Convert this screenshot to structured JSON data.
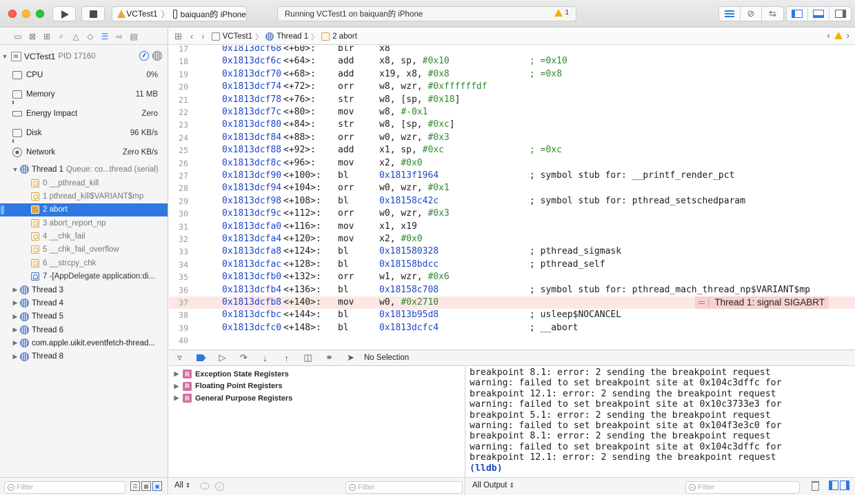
{
  "toolbar": {
    "scheme_app": "VCTest1",
    "scheme_device": "baiquan的 iPhone",
    "status_text": "Running VCTest1 on baiquan的 iPhone",
    "warning_count": "1",
    "editor_icons": [
      "standard-editor-icon",
      "assistant-editor-icon",
      "version-editor-icon"
    ],
    "view_icons": [
      "navigator-toggle-icon",
      "debug-area-toggle-icon",
      "utilities-toggle-icon"
    ]
  },
  "navigator": {
    "tab_icons": [
      "folder-icon",
      "source-control-icon",
      "hierarchy-icon",
      "find-icon",
      "issue-icon",
      "test-icon",
      "debug-icon",
      "breakpoint-icon",
      "report-icon"
    ],
    "process": {
      "name": "VCTest1",
      "pid": "PID 17160"
    },
    "gauges": [
      {
        "label": "CPU",
        "value": "0%"
      },
      {
        "label": "Memory",
        "value": "11 MB"
      },
      {
        "label": "Energy Impact",
        "value": "Zero"
      },
      {
        "label": "Disk",
        "value": "96 KB/s"
      },
      {
        "label": "Network",
        "value": "Zero KB/s"
      }
    ],
    "thread1": {
      "name": "Thread 1",
      "queue": "Queue: co...thread (serial)"
    },
    "frames": [
      {
        "label": "0 __pthread_kill",
        "kind": "system"
      },
      {
        "label": "1 pthread_kill$VARIANT$mp",
        "kind": "system"
      },
      {
        "label": "2 abort",
        "kind": "system",
        "selected": true
      },
      {
        "label": "3 abort_report_np",
        "kind": "system"
      },
      {
        "label": "4 __chk_fail",
        "kind": "system"
      },
      {
        "label": "5 __chk_fail_overflow",
        "kind": "system"
      },
      {
        "label": "6 __strcpy_chk",
        "kind": "system"
      },
      {
        "label": "7 -[AppDelegate application:di...",
        "kind": "user"
      }
    ],
    "other_threads": [
      "Thread 3",
      "Thread 4",
      "Thread 5",
      "Thread 6",
      "com.apple.uikit.eventfetch-thread...",
      "Thread 8"
    ],
    "filter_placeholder": "Filter"
  },
  "jumpbar": {
    "items": [
      "VCTest1",
      "Thread 1",
      "2 abort"
    ]
  },
  "code_lines": [
    {
      "ln": "17",
      "addr": "0x1813dcf68",
      "off": "<+60>:",
      "mn": "blr",
      "ops": [
        [
          "x8",
          ""
        ]
      ],
      "cmt": "",
      "cmt_green": false
    },
    {
      "ln": "18",
      "addr": "0x1813dcf6c",
      "off": "<+64>:",
      "mn": "add",
      "ops": [
        [
          "x8, sp, ",
          ""
        ],
        [
          "#0x10",
          "num"
        ]
      ],
      "cmt": "; =0x10",
      "cmt_green": true
    },
    {
      "ln": "19",
      "addr": "0x1813dcf70",
      "off": "<+68>:",
      "mn": "add",
      "ops": [
        [
          "x19, x8, ",
          ""
        ],
        [
          "#0x8",
          "num"
        ]
      ],
      "cmt": "; =0x8",
      "cmt_green": true
    },
    {
      "ln": "20",
      "addr": "0x1813dcf74",
      "off": "<+72>:",
      "mn": "orr",
      "ops": [
        [
          "w8, wzr, ",
          ""
        ],
        [
          "#0xffffffdf",
          "num"
        ]
      ],
      "cmt": "",
      "cmt_green": false
    },
    {
      "ln": "21",
      "addr": "0x1813dcf78",
      "off": "<+76>:",
      "mn": "str",
      "ops": [
        [
          "w8, [sp, ",
          ""
        ],
        [
          "#0x18",
          "num"
        ],
        [
          "]",
          ""
        ]
      ],
      "cmt": "",
      "cmt_green": false
    },
    {
      "ln": "22",
      "addr": "0x1813dcf7c",
      "off": "<+80>:",
      "mn": "mov",
      "ops": [
        [
          "w8, ",
          ""
        ],
        [
          "#-0x1",
          "num"
        ]
      ],
      "cmt": "",
      "cmt_green": false
    },
    {
      "ln": "23",
      "addr": "0x1813dcf80",
      "off": "<+84>:",
      "mn": "str",
      "ops": [
        [
          "w8, [sp, ",
          ""
        ],
        [
          "#0xc",
          "num"
        ],
        [
          "]",
          ""
        ]
      ],
      "cmt": "",
      "cmt_green": false
    },
    {
      "ln": "24",
      "addr": "0x1813dcf84",
      "off": "<+88>:",
      "mn": "orr",
      "ops": [
        [
          "w0, wzr, ",
          ""
        ],
        [
          "#0x3",
          "num"
        ]
      ],
      "cmt": "",
      "cmt_green": false
    },
    {
      "ln": "25",
      "addr": "0x1813dcf88",
      "off": "<+92>:",
      "mn": "add",
      "ops": [
        [
          "x1, sp, ",
          ""
        ],
        [
          "#0xc",
          "num"
        ]
      ],
      "cmt": "; =0xc",
      "cmt_green": true
    },
    {
      "ln": "26",
      "addr": "0x1813dcf8c",
      "off": "<+96>:",
      "mn": "mov",
      "ops": [
        [
          "x2, ",
          ""
        ],
        [
          "#0x0",
          "num"
        ]
      ],
      "cmt": "",
      "cmt_green": false
    },
    {
      "ln": "27",
      "addr": "0x1813dcf90",
      "off": "<+100>:",
      "mn": "bl",
      "ops": [
        [
          "0x1813f1964",
          "addr2"
        ]
      ],
      "cmt": "; symbol stub for: __printf_render_pct",
      "cmt_green": false
    },
    {
      "ln": "28",
      "addr": "0x1813dcf94",
      "off": "<+104>:",
      "mn": "orr",
      "ops": [
        [
          "w0, wzr, ",
          ""
        ],
        [
          "#0x1",
          "num"
        ]
      ],
      "cmt": "",
      "cmt_green": false
    },
    {
      "ln": "29",
      "addr": "0x1813dcf98",
      "off": "<+108>:",
      "mn": "bl",
      "ops": [
        [
          "0x18158c42c",
          "addr2"
        ]
      ],
      "cmt": "; symbol stub for: pthread_setschedparam",
      "cmt_green": false
    },
    {
      "ln": "30",
      "addr": "0x1813dcf9c",
      "off": "<+112>:",
      "mn": "orr",
      "ops": [
        [
          "w0, wzr, ",
          ""
        ],
        [
          "#0x3",
          "num"
        ]
      ],
      "cmt": "",
      "cmt_green": false
    },
    {
      "ln": "31",
      "addr": "0x1813dcfa0",
      "off": "<+116>:",
      "mn": "mov",
      "ops": [
        [
          "x1, x19",
          ""
        ]
      ],
      "cmt": "",
      "cmt_green": false
    },
    {
      "ln": "32",
      "addr": "0x1813dcfa4",
      "off": "<+120>:",
      "mn": "mov",
      "ops": [
        [
          "x2, ",
          ""
        ],
        [
          "#0x0",
          "num"
        ]
      ],
      "cmt": "",
      "cmt_green": false
    },
    {
      "ln": "33",
      "addr": "0x1813dcfa8",
      "off": "<+124>:",
      "mn": "bl",
      "ops": [
        [
          "0x181580328",
          "addr2"
        ]
      ],
      "cmt": "; pthread_sigmask",
      "cmt_green": false
    },
    {
      "ln": "34",
      "addr": "0x1813dcfac",
      "off": "<+128>:",
      "mn": "bl",
      "ops": [
        [
          "0x18158bdcc",
          "addr2"
        ]
      ],
      "cmt": "; pthread_self",
      "cmt_green": false
    },
    {
      "ln": "35",
      "addr": "0x1813dcfb0",
      "off": "<+132>:",
      "mn": "orr",
      "ops": [
        [
          "w1, wzr, ",
          ""
        ],
        [
          "#0x6",
          "num"
        ]
      ],
      "cmt": "",
      "cmt_green": false
    },
    {
      "ln": "36",
      "addr": "0x1813dcfb4",
      "off": "<+136>:",
      "mn": "bl",
      "ops": [
        [
          "0x18158c708",
          "addr2"
        ]
      ],
      "cmt": "; symbol stub for: pthread_mach_thread_np$VARIANT$mp",
      "cmt_green": false
    },
    {
      "ln": "37",
      "addr": "0x1813dcfb8",
      "off": "<+140>:",
      "mn": "mov",
      "ops": [
        [
          "w0, ",
          ""
        ],
        [
          "#0x2710",
          "num"
        ]
      ],
      "cmt": "",
      "cmt_green": false,
      "crash": "Thread 1: signal SIGABRT"
    },
    {
      "ln": "38",
      "addr": "0x1813dcfbc",
      "off": "<+144>:",
      "mn": "bl",
      "ops": [
        [
          "0x1813b95d8",
          "addr2"
        ]
      ],
      "cmt": "; usleep$NOCANCEL",
      "cmt_green": false
    },
    {
      "ln": "39",
      "addr": "0x1813dcfc0",
      "off": "<+148>:",
      "mn": "bl",
      "ops": [
        [
          "0x1813dcfc4",
          "addr2"
        ]
      ],
      "cmt": "; __abort",
      "cmt_green": false
    },
    {
      "ln": "40",
      "addr": "",
      "off": "",
      "mn": "",
      "ops": [],
      "cmt": "",
      "cmt_green": false
    }
  ],
  "debugbar": {
    "selection": "No Selection"
  },
  "variables": {
    "groups": [
      "Exception State Registers",
      "Floating Point Registers",
      "General Purpose Registers"
    ],
    "scope": "All",
    "filter_placeholder": "Filter"
  },
  "console": {
    "lines": [
      "breakpoint 8.1: error: 2 sending the breakpoint request",
      "warning: failed to set breakpoint site at 0x104c3dffc for",
      "breakpoint 12.1: error: 2 sending the breakpoint request",
      "warning: failed to set breakpoint site at 0x10c3733e3 for",
      "breakpoint 5.1: error: 2 sending the breakpoint request",
      "warning: failed to set breakpoint site at 0x104f3e3c0 for",
      "breakpoint 8.1: error: 2 sending the breakpoint request",
      "warning: failed to set breakpoint site at 0x104c3dffc for",
      "breakpoint 12.1: error: 2 sending the breakpoint request"
    ],
    "prompt": "(lldb)",
    "output_scope": "All Output",
    "filter_placeholder": "Filter"
  },
  "colors": {
    "accent": "#2f78e2",
    "address": "#1e46c8",
    "number": "#2f8a2f",
    "crash_line": "#fbe8e6",
    "crash_badge": "#f7d3cf"
  }
}
